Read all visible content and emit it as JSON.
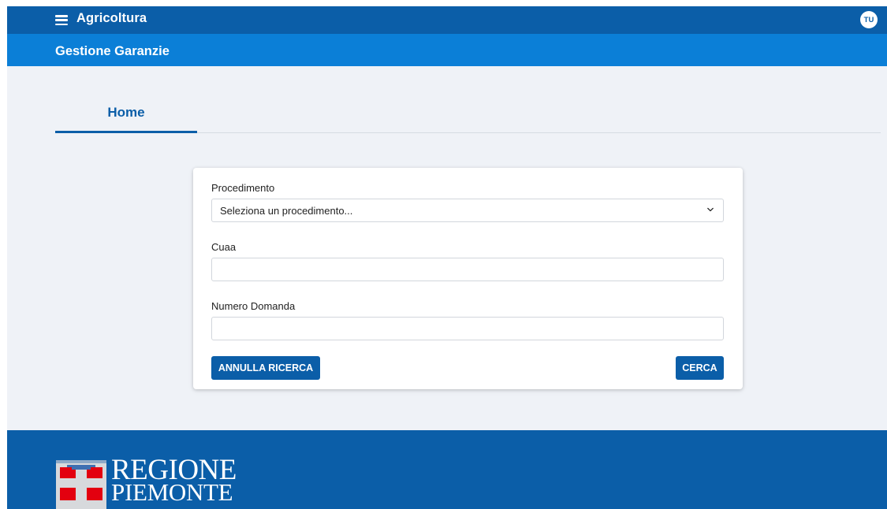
{
  "header": {
    "app_title": "Agricoltura",
    "user_initials": "TU",
    "menu_icon": "hamburger-menu-icon"
  },
  "subheader": {
    "title": "Gestione Garanzie"
  },
  "tabs": [
    {
      "label": "Home",
      "active": true
    }
  ],
  "form": {
    "procedimento": {
      "label": "Procedimento",
      "selected": "Seleziona un procedimento..."
    },
    "cuaa": {
      "label": "Cuaa",
      "value": "",
      "placeholder": ""
    },
    "numero_domanda": {
      "label": "Numero Domanda",
      "value": "",
      "placeholder": ""
    },
    "reset_button": "ANNULLA RICERCA",
    "search_button": "CERCA"
  },
  "footer": {
    "logo_line1": "REGIONE",
    "logo_line2": "PIEMONTE"
  },
  "colors": {
    "primary": "#0b5ea8",
    "secondary_bar": "#0b7fd7",
    "page_background": "#eff2f7",
    "logo_red": "#e3000f"
  }
}
